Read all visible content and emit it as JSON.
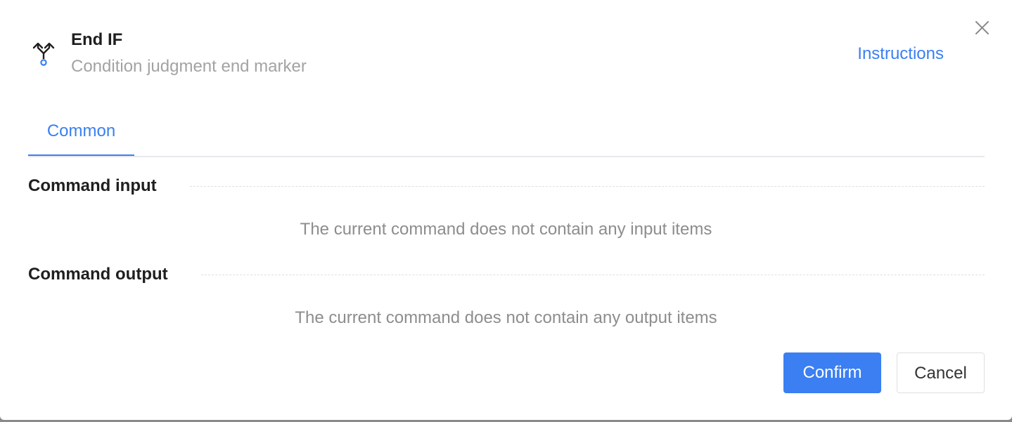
{
  "dialog": {
    "title": "End IF",
    "subtitle": "Condition judgment end marker",
    "instructions_link": "Instructions",
    "icon": "branch-merge-icon",
    "close_icon": "close-icon"
  },
  "tabs": [
    {
      "label": "Common",
      "active": true
    }
  ],
  "sections": {
    "input": {
      "title": "Command input",
      "empty_text": "The current command does not contain any input items"
    },
    "output": {
      "title": "Command output",
      "empty_text": "The current command does not contain any output items"
    }
  },
  "footer": {
    "confirm_label": "Confirm",
    "cancel_label": "Cancel"
  },
  "colors": {
    "accent": "#3b7ff2",
    "title_text": "#1f1f1f",
    "muted_text": "#a3a3a3"
  }
}
